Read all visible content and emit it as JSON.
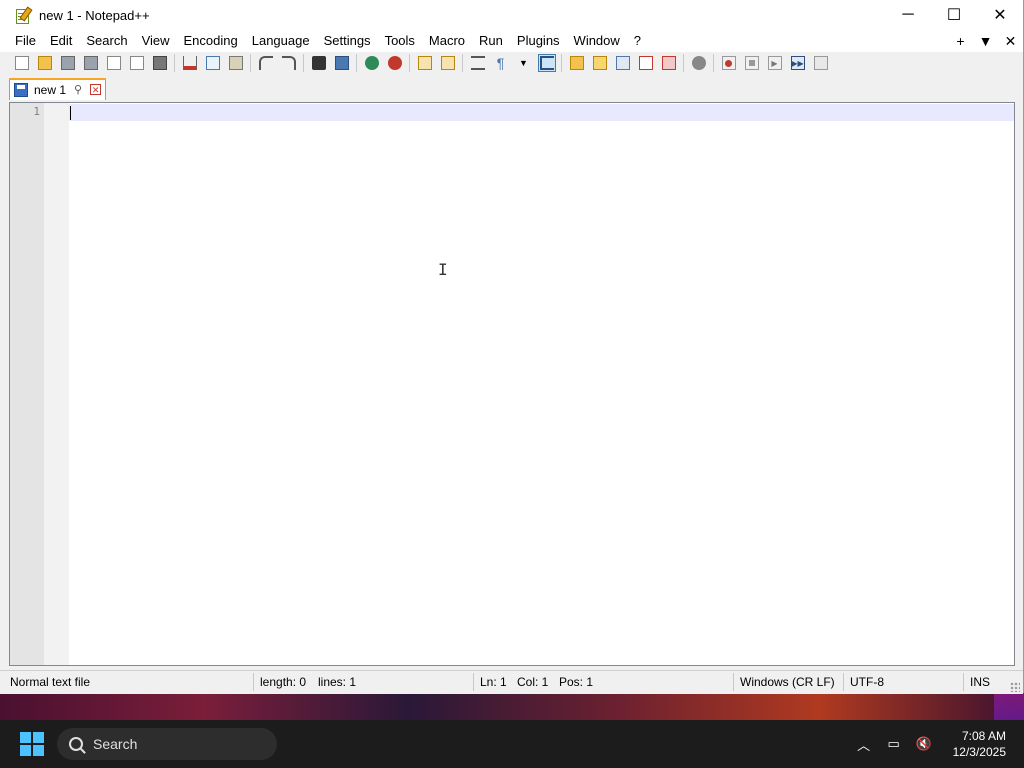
{
  "window": {
    "title": "new 1 - Notepad++",
    "controls": {
      "minimize": "─",
      "maximize": "☐",
      "close": "✕"
    }
  },
  "menu": {
    "items": [
      "File",
      "Edit",
      "Search",
      "View",
      "Encoding",
      "Language",
      "Settings",
      "Tools",
      "Macro",
      "Run",
      "Plugins",
      "Window",
      "?"
    ],
    "right": {
      "add": "+",
      "list": "▼",
      "close": "✕"
    }
  },
  "tabs": [
    {
      "label": "new 1",
      "pin": "📌",
      "close": "✕"
    }
  ],
  "editor": {
    "line_numbers": [
      "1"
    ],
    "content": ""
  },
  "statusbar": {
    "file_type": "Normal text file",
    "length": "length: 0",
    "lines": "lines: 1",
    "ln": "Ln: 1",
    "col": "Col: 1",
    "pos": "Pos: 1",
    "eol": "Windows (CR LF)",
    "encoding": "UTF-8",
    "mode": "INS"
  },
  "taskbar": {
    "search_placeholder": "Search",
    "time": "7:08 AM",
    "date": "12/3/2025"
  },
  "colors": {
    "accent": "#4cc2ff",
    "tab_highlight": "#f5a623",
    "current_line": "#e8e8ff"
  }
}
